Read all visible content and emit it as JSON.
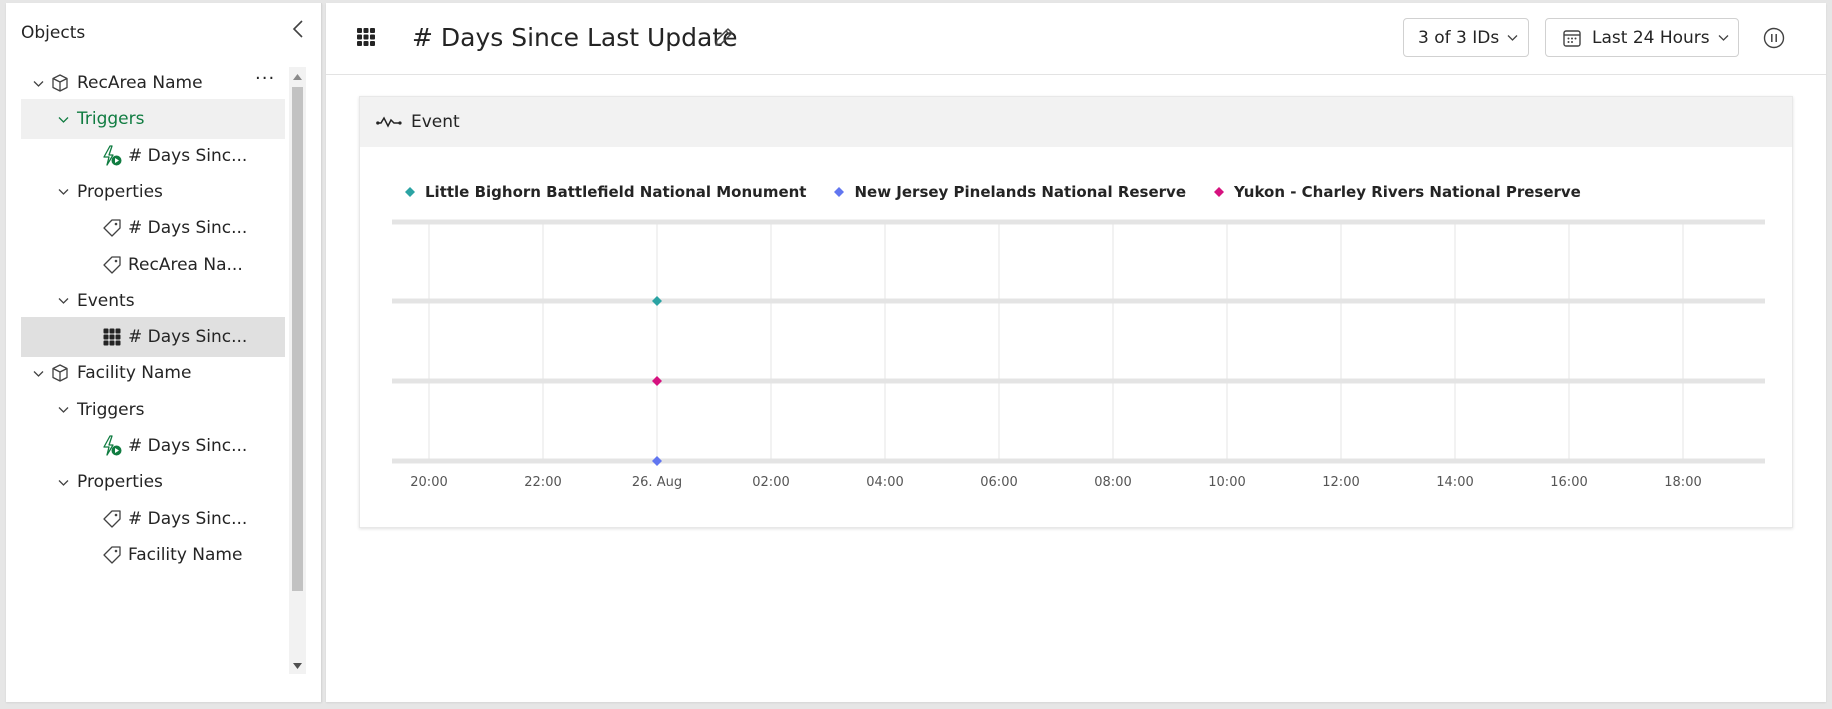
{
  "left_panel": {
    "title": "Objects",
    "tree": [
      {
        "label": "RecArea Name",
        "icon": "cube-icon",
        "level": 0,
        "expanded": true,
        "has_more": true,
        "more_label": "···"
      },
      {
        "label": "Triggers",
        "icon": "",
        "level": 1,
        "expanded": true,
        "selected": "green"
      },
      {
        "label": "# Days Sinc...",
        "icon": "trigger-icon",
        "level": 2
      },
      {
        "label": "Properties",
        "icon": "",
        "level": 1,
        "expanded": true
      },
      {
        "label": "# Days Sinc...",
        "icon": "tag-icon",
        "level": 2
      },
      {
        "label": "RecArea Na...",
        "icon": "tag-icon",
        "level": 2
      },
      {
        "label": "Events",
        "icon": "",
        "level": 1,
        "expanded": true
      },
      {
        "label": "# Days Sinc...",
        "icon": "table-icon",
        "level": 2,
        "selected": "grey"
      },
      {
        "label": "Facility Name",
        "icon": "cube-icon",
        "level": 0,
        "expanded": true
      },
      {
        "label": "Triggers",
        "icon": "",
        "level": 1,
        "expanded": true
      },
      {
        "label": "# Days Sinc...",
        "icon": "trigger-icon",
        "level": 2
      },
      {
        "label": "Properties",
        "icon": "",
        "level": 1,
        "expanded": true
      },
      {
        "label": "# Days Sinc...",
        "icon": "tag-icon",
        "level": 2
      },
      {
        "label": "Facility Name",
        "icon": "tag-icon",
        "level": 2
      }
    ]
  },
  "header": {
    "title": "# Days Since Last Update",
    "ids_label": "3 of 3 IDs",
    "range_label": "Last 24 Hours"
  },
  "card": {
    "title": "Event"
  },
  "colors": {
    "accent_green": "#107c41",
    "series_teal": "#2ba3a3",
    "series_blue": "#6176f0",
    "series_magenta": "#d6127f"
  },
  "chart_data": {
    "type": "scatter",
    "series": [
      {
        "name": "Little Bighorn Battlefield National Monument",
        "color": "#2ba3a3",
        "row": 0,
        "x": [
          "26. Aug 00:00"
        ]
      },
      {
        "name": "New Jersey Pinelands National Reserve",
        "color": "#6176f0",
        "row": 2,
        "x": [
          "26. Aug 00:00"
        ]
      },
      {
        "name": "Yukon - Charley Rivers National Preserve",
        "color": "#d6127f",
        "row": 1,
        "x": [
          "26. Aug 00:00"
        ]
      }
    ],
    "x_ticks": [
      "20:00",
      "22:00",
      "26. Aug",
      "02:00",
      "04:00",
      "06:00",
      "08:00",
      "10:00",
      "12:00",
      "14:00",
      "16:00",
      "18:00"
    ],
    "grid": true,
    "legend": "top-left"
  }
}
